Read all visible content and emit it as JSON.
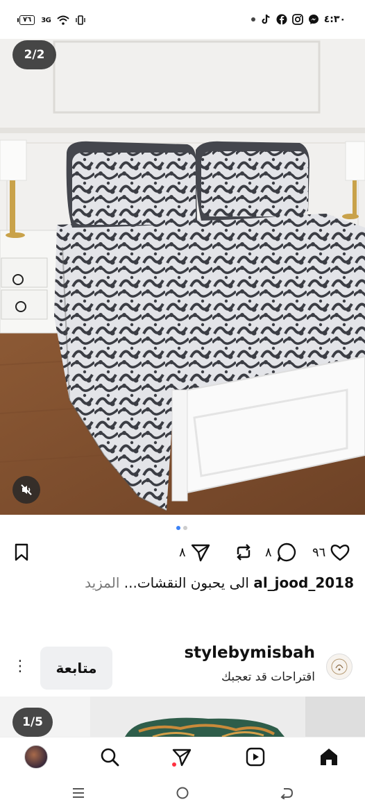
{
  "status_bar": {
    "time": "٤:٣٠",
    "battery": "٧٦",
    "network": "3G",
    "app_icons": [
      "tiktok-icon",
      "facebook-icon",
      "instagram-icon",
      "messenger-icon"
    ]
  },
  "post": {
    "image_counter": "2/2",
    "image_alt": "bed with grey and white damask ruffled bedspread",
    "carousel_dots": 2,
    "active_dot": 0,
    "likes": "٩٦",
    "comments": "٨",
    "reposts": "٨",
    "caption_username": "al_jood_2018",
    "caption_text": "الى يحبون النقشات...",
    "caption_more": "المزيد"
  },
  "suggestion": {
    "username": "stylebymisbah",
    "subtitle": "اقتراحات قد تعجبك",
    "follow_label": "متابعة"
  },
  "next_post": {
    "image_counter": "1/5"
  },
  "colors": {
    "accent": "#3b82f6",
    "badge_bg": "#282828",
    "follow_bg": "#eff0f2",
    "notification_dot": "#ff3040"
  }
}
